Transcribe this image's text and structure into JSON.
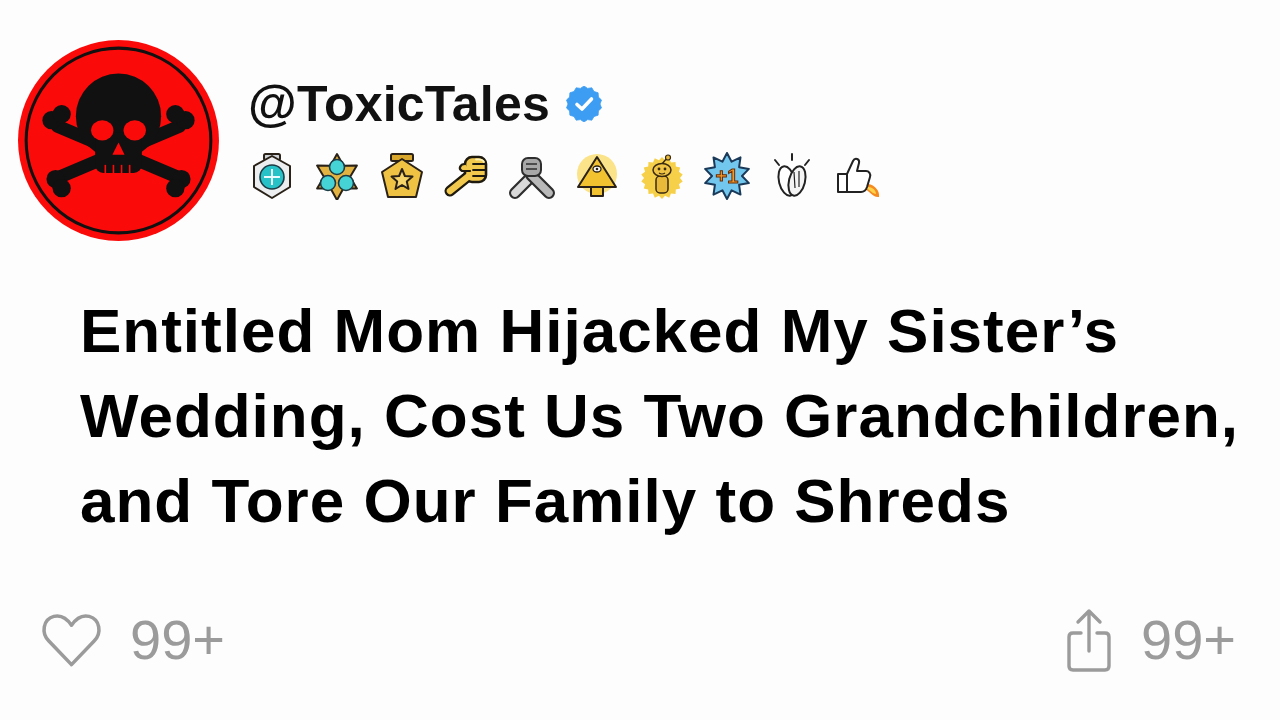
{
  "author": {
    "handle": "@ToxicTales",
    "verified": true,
    "badges": [
      {
        "kind": "hexagon_medal"
      },
      {
        "kind": "gem_cluster"
      },
      {
        "kind": "star_pentagon"
      },
      {
        "kind": "pointing_hand"
      },
      {
        "kind": "arm_wrestle"
      },
      {
        "kind": "pyramid"
      },
      {
        "kind": "mascot"
      },
      {
        "kind": "plus_one",
        "text": "+1"
      },
      {
        "kind": "clapping_hands"
      },
      {
        "kind": "rocket_thumb"
      }
    ]
  },
  "title": "Entitled Mom Hijacked My Sister’s Wedding, Cost Us Two Grandchildren, and Tore Our Family to Shreds",
  "actions": [
    {
      "kind": "like",
      "count": "99+"
    },
    {
      "kind": "share",
      "count": "99+"
    }
  ]
}
